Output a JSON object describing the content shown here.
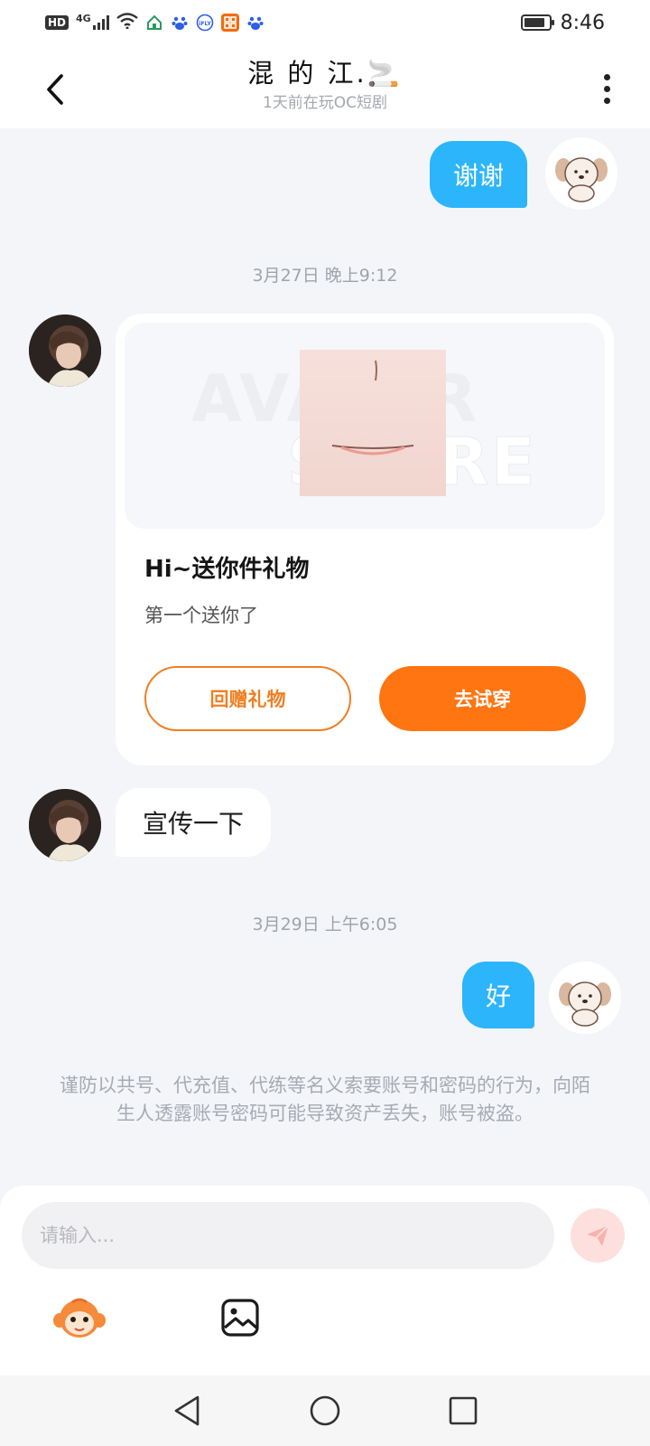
{
  "status_bar": {
    "network_label": "HD",
    "network_type": "4G",
    "time": "8:46",
    "battery_level": 0.85
  },
  "header": {
    "title": "混 的 江.🚬",
    "subtitle": "1天前在玩OC短剧"
  },
  "messages": {
    "msg1_text": "谢谢",
    "timestamp1": "3月27日 晚上9:12",
    "gift_title": "Hi~送你件礼物",
    "gift_desc": "第一个送你了",
    "gift_watermark_line1": "AVATAR",
    "gift_watermark_line2": "STORE",
    "gift_return_label": "回赠礼物",
    "gift_try_label": "去试穿",
    "msg3_text": "宣传一下",
    "timestamp2": "3月29日 上午6:05",
    "msg4_text": "好"
  },
  "warning_text": "谨防以共号、代充值、代练等名义索要账号和密码的行为，向陌生人透露账号密码可能导致资产丢失，账号被盗。",
  "input": {
    "placeholder": "请输入..."
  },
  "colors": {
    "accent_blue": "#2cb5fb",
    "accent_orange": "#ff7512",
    "background": "#f3f5f9"
  }
}
